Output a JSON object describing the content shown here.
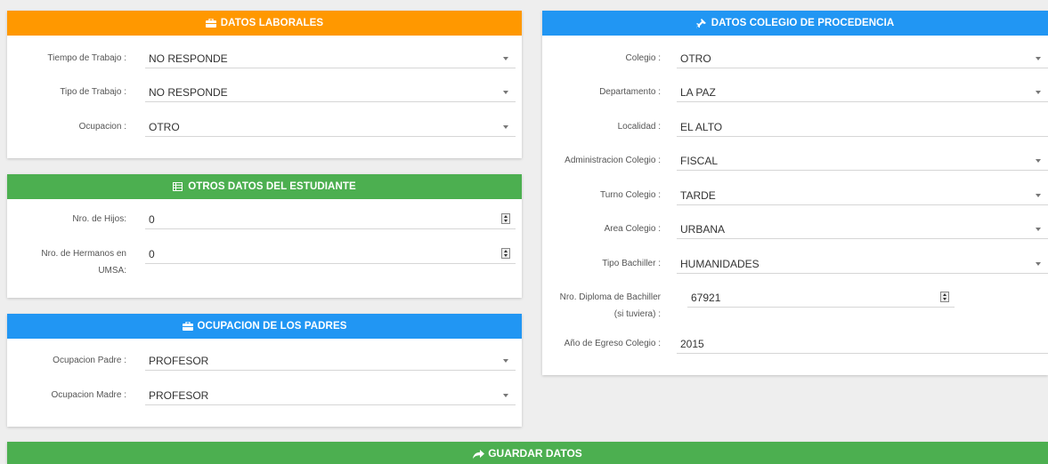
{
  "laborales": {
    "title": "DATOS LABORALES",
    "fields": [
      {
        "label": "Tiempo de Trabajo :",
        "value": "NO RESPONDE"
      },
      {
        "label": "Tipo de Trabajo :",
        "value": "NO RESPONDE"
      },
      {
        "label": "Ocupacion :",
        "value": "OTRO"
      }
    ]
  },
  "otros": {
    "title": "OTROS DATOS DEL ESTUDIANTE",
    "hijos_label": "Nro. de Hijos:",
    "hijos_value": "0",
    "hermanos_label_1": "Nro. de Hermanos en",
    "hermanos_label_2": "UMSA:",
    "hermanos_value": "0"
  },
  "padres": {
    "title": "OCUPACION DE LOS PADRES",
    "fields": [
      {
        "label": "Ocupacion Padre :",
        "value": "PROFESOR"
      },
      {
        "label": "Ocupacion Madre :",
        "value": "PROFESOR"
      }
    ]
  },
  "colegio": {
    "title": "DATOS COLEGIO DE PROCEDENCIA",
    "colegio_label": "Colegio :",
    "colegio_value": "OTRO",
    "departamento_label": "Departamento :",
    "departamento_value": "LA PAZ",
    "localidad_label": "Localidad :",
    "localidad_value": "EL ALTO",
    "administracion_label": "Administracion Colegio :",
    "administracion_value": "FISCAL",
    "turno_label": "Turno Colegio :",
    "turno_value": "TARDE",
    "area_label": "Area Colegio :",
    "area_value": "URBANA",
    "bachiller_label": "Tipo Bachiller :",
    "bachiller_value": "HUMANIDADES",
    "diploma_label_1": "Nro. Diploma de Bachiller",
    "diploma_label_2": "(si tuviera) :",
    "diploma_value": "67921",
    "egreso_label": "Año de Egreso Colegio :",
    "egreso_value": "2015"
  },
  "save_label": "GUARDAR DATOS"
}
